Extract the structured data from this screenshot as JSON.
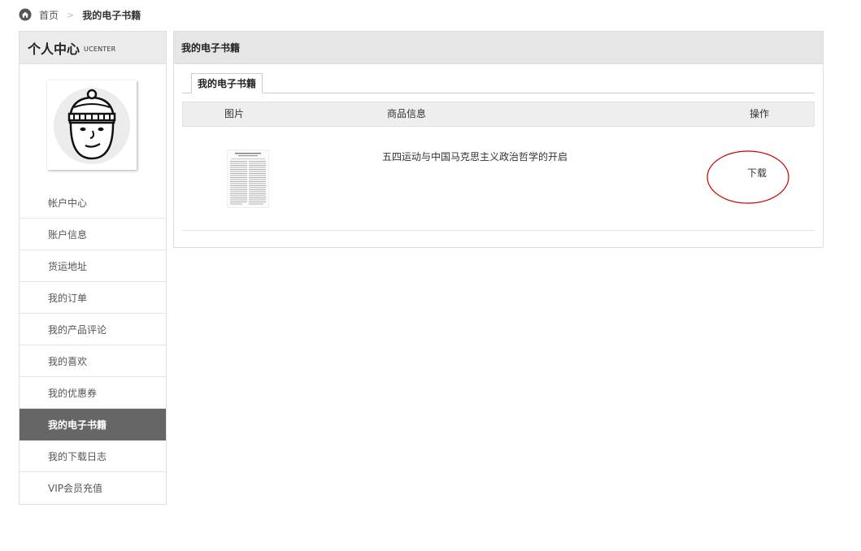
{
  "breadcrumb": {
    "home": "首页",
    "separator": ">",
    "current": "我的电子书籍"
  },
  "sidebar": {
    "title": "个人中心",
    "subtitle": "UCENTER",
    "items": [
      {
        "label": "帐户中心"
      },
      {
        "label": "账户信息"
      },
      {
        "label": "货运地址"
      },
      {
        "label": "我的订单"
      },
      {
        "label": "我的产品评论"
      },
      {
        "label": "我的喜欢"
      },
      {
        "label": "我的优惠券"
      },
      {
        "label": "我的电子书籍",
        "active": true
      },
      {
        "label": "我的下载日志"
      },
      {
        "label": "VIP会员充值"
      }
    ]
  },
  "main": {
    "title": "我的电子书籍",
    "tab": "我的电子书籍",
    "table": {
      "headers": {
        "image": "图片",
        "info": "商品信息",
        "operation": "操作"
      },
      "rows": [
        {
          "product": "五四运动与中国马克思主义政治哲学的开启",
          "action": "下载"
        }
      ]
    }
  },
  "colors": {
    "active_nav": "#666666",
    "header_bg": "#e6e6e6",
    "annotation": "#cc0000"
  },
  "icons": [
    "home-icon",
    "avatar-beanie-face",
    "document-thumbnail"
  ]
}
